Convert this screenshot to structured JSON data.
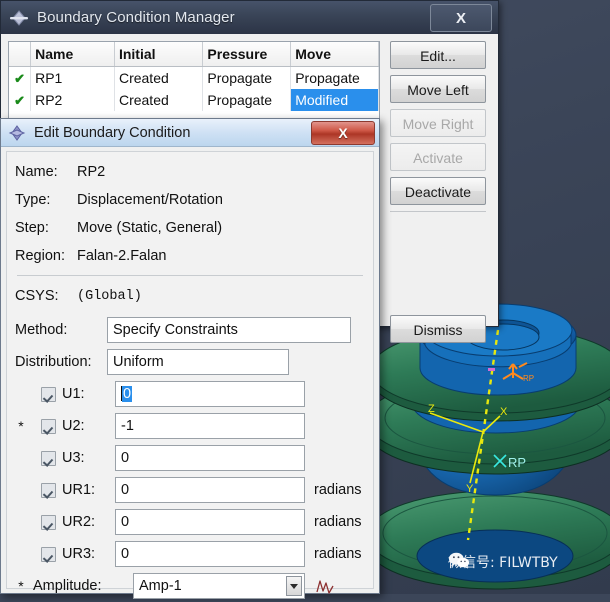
{
  "bcm": {
    "title": "Boundary Condition Manager",
    "close_label": "X",
    "table": {
      "headers": [
        "",
        "Name",
        "Initial",
        "Pressure",
        "Move"
      ],
      "rows": [
        {
          "check": "✔",
          "name": "RP1",
          "initial": "Created",
          "pressure": "Propagate",
          "move": "Propagate",
          "move_selected": false
        },
        {
          "check": "✔",
          "name": "RP2",
          "initial": "Created",
          "pressure": "Propagate",
          "move": "Modified",
          "move_selected": true
        }
      ]
    },
    "buttons": [
      {
        "label": "Edit...",
        "enabled": true
      },
      {
        "label": "Move Left",
        "enabled": true
      },
      {
        "label": "Move Right",
        "enabled": false
      },
      {
        "label": "Activate",
        "enabled": false
      },
      {
        "label": "Deactivate",
        "enabled": true
      }
    ],
    "dismiss_label": "Dismiss"
  },
  "edit_dialog": {
    "title": "Edit Boundary Condition",
    "close_label": "X",
    "fields": {
      "name_label": "Name:",
      "name_value": "RP2",
      "type_label": "Type:",
      "type_value": "Displacement/Rotation",
      "step_label": "Step:",
      "step_value": "Move (Static, General)",
      "region_label": "Region:",
      "region_value": "Falan-2.Falan",
      "csys_label": "CSYS:",
      "csys_value": "(Global)",
      "method_label": "Method:",
      "method_value": "Specify Constraints",
      "distribution_label": "Distribution:",
      "distribution_value": "Uniform"
    },
    "dof": [
      {
        "star": "",
        "label": "U1:",
        "value": "0",
        "unit": "",
        "checked": true,
        "value_selected": true
      },
      {
        "star": "*",
        "label": "U2:",
        "value": "-1",
        "unit": "",
        "checked": true,
        "value_selected": false
      },
      {
        "star": "",
        "label": "U3:",
        "value": "0",
        "unit": "",
        "checked": true,
        "value_selected": false
      },
      {
        "star": "",
        "label": "UR1:",
        "value": "0",
        "unit": "radians",
        "checked": true,
        "value_selected": false
      },
      {
        "star": "",
        "label": "UR2:",
        "value": "0",
        "unit": "radians",
        "checked": true,
        "value_selected": false
      },
      {
        "star": "",
        "label": "UR3:",
        "value": "0",
        "unit": "radians",
        "checked": true,
        "value_selected": false
      }
    ],
    "amplitude": {
      "star": "*",
      "label": "Amplitude:",
      "value": "Amp-1"
    }
  },
  "viewport": {
    "axis_labels": {
      "x": "X",
      "y": "Y",
      "z": "Z"
    },
    "reference_point_label": "RP",
    "watermark": "微信号: FILWTBY"
  },
  "colors": {
    "selection_blue": "#2a8fec",
    "checkmark_green": "#1a8a1a",
    "close_red": "#cf5948",
    "model_blue": "#1565b0",
    "model_green": "#2f7a5a",
    "axis_yellow": "#e8e80e",
    "desktop": "#3c4659"
  }
}
